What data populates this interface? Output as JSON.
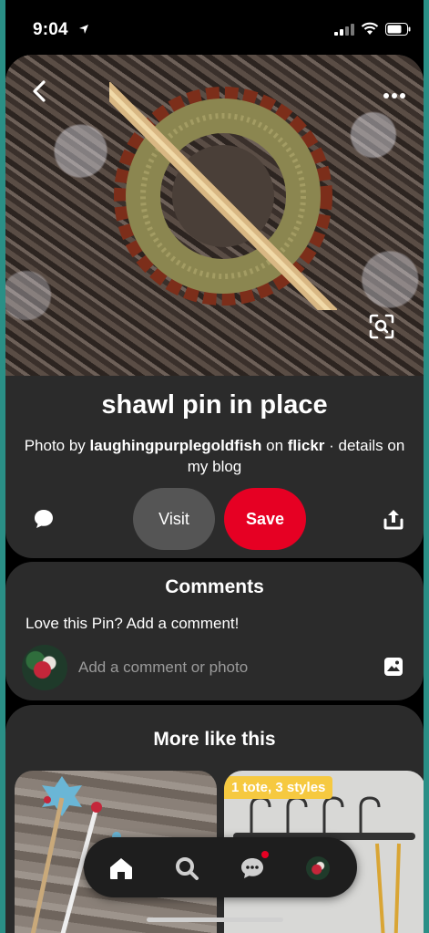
{
  "status_bar": {
    "time": "9:04"
  },
  "pin": {
    "title": "shawl pin in place",
    "attribution": {
      "prefix": "Photo by ",
      "author": "laughingpurplegoldfish",
      "middle": " on ",
      "source": "flickr",
      "suffix": " · details on my blog"
    }
  },
  "actions": {
    "visit_label": "Visit",
    "save_label": "Save"
  },
  "comments": {
    "title": "Comments",
    "prompt": "Love this Pin? Add a comment!",
    "placeholder": "Add a comment or photo"
  },
  "more": {
    "title": "More like this",
    "tag": "1 tote, 3 styles"
  },
  "colors": {
    "accent_red": "#e60023",
    "card_bg": "#2b2b2b",
    "visit_bg": "#555555",
    "tag_yellow": "#f6c940"
  },
  "icons": {
    "back": "chevron-left-icon",
    "more": "ellipsis-icon",
    "lens": "visual-search-icon",
    "comment": "speech-bubble-icon",
    "share": "share-icon",
    "photo": "image-icon",
    "home": "home-icon",
    "search": "search-icon",
    "messages": "chat-icon"
  }
}
